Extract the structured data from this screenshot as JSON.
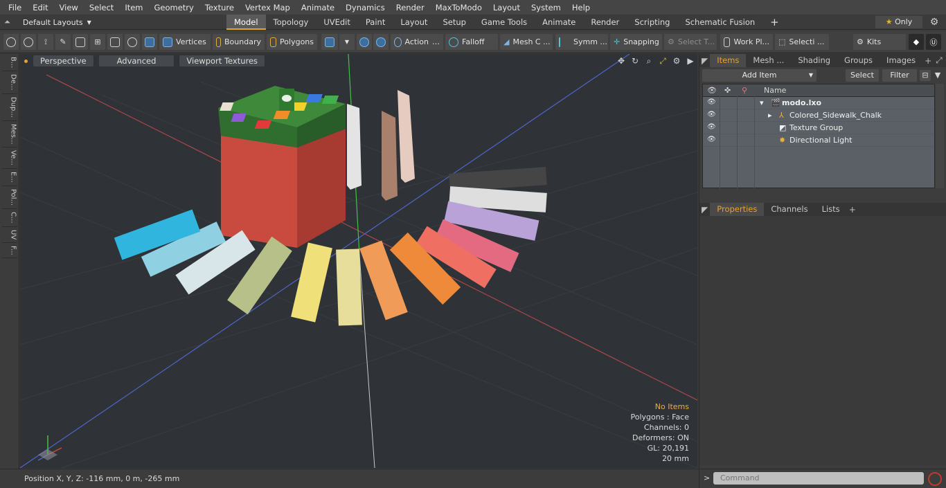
{
  "menu": [
    "File",
    "Edit",
    "View",
    "Select",
    "Item",
    "Geometry",
    "Texture",
    "Vertex Map",
    "Animate",
    "Dynamics",
    "Render",
    "MaxToModo",
    "Layout",
    "System",
    "Help"
  ],
  "layout": {
    "preset": "Default Layouts",
    "tabs": [
      "Model",
      "Topology",
      "UVEdit",
      "Paint",
      "Layout",
      "Setup",
      "Game Tools",
      "Animate",
      "Render",
      "Scripting",
      "Schematic Fusion"
    ],
    "active_tab": "Model",
    "only_label": "Only"
  },
  "toolbar": {
    "vertices": "Vertices",
    "boundary": "Boundary",
    "polygons": "Polygons",
    "action": "Action",
    "falloff": "Falloff",
    "mesh": "Mesh C ...",
    "symmetry": "Symm ...",
    "snapping": "Snapping",
    "select_t": "Select T...",
    "work_plane": "Work Pl...",
    "selection": "Selecti ...",
    "kits": "Kits"
  },
  "left_tabs": [
    "B...",
    "De...",
    "Dup...",
    "Mes...",
    "Ve...",
    "E...",
    "Pol...",
    "C...",
    "UV",
    "F..."
  ],
  "viewport": {
    "view_mode": "Perspective",
    "advanced": "Advanced",
    "textures": "Viewport Textures",
    "stats": {
      "selection": "No Items",
      "polygons": "Polygons : Face",
      "channels": "Channels: 0",
      "deformers": "Deformers: ON",
      "gl": "GL: 20,191",
      "unit": "20 mm"
    }
  },
  "status": {
    "position": "Position X, Y, Z:   -116 mm, 0 m, -265 mm"
  },
  "items_panel": {
    "tabs": [
      "Items",
      "Mesh ...",
      "Shading",
      "Groups",
      "Images"
    ],
    "active_tab": "Items",
    "add_item": "Add Item",
    "select": "Select",
    "filter": "Filter",
    "name_header": "Name",
    "rows": [
      {
        "label": "modo.lxo",
        "indent": 0,
        "bold": true
      },
      {
        "label": "Colored_Sidewalk_Chalk",
        "indent": 1
      },
      {
        "label": "Texture Group",
        "indent": 1
      },
      {
        "label": "Directional Light",
        "indent": 1
      }
    ]
  },
  "properties_panel": {
    "tabs": [
      "Properties",
      "Channels",
      "Lists"
    ],
    "active_tab": "Properties"
  },
  "command": {
    "placeholder": "Command"
  },
  "colors": {
    "accent": "#e8a22e",
    "viewport_bg": "#2f3337"
  }
}
